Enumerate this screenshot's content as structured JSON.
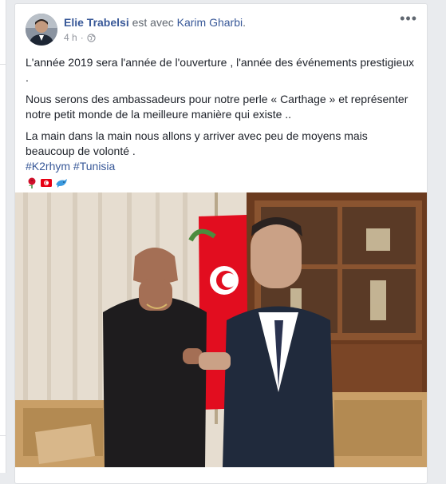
{
  "post": {
    "author": "Elie Trabelsi",
    "with_text": "est avec",
    "tagged": "Karim Gharbi",
    "tagged_suffix": ".",
    "time": "4 h",
    "more": "•••",
    "paragraphs": [
      "L'année 2019 sera l'année de l'ouverture , l'année des événements prestigieux .",
      "Nous serons des ambassadeurs pour notre perle « Carthage » et représenter notre petit monde de la meilleure manière qui existe ..",
      "La main dans la main nous allons y arriver avec peu de moyens mais beaucoup de volonté ."
    ],
    "hashtags": [
      "#K2rhym",
      "#Tunisia"
    ],
    "emojis": [
      "rose-emoji",
      "tunisia-flag-emoji",
      "dolphin-emoji"
    ],
    "icons": {
      "privacy": "globe-icon",
      "more": "more-options-icon"
    }
  },
  "colors": {
    "link": "#385898",
    "text": "#1d2129",
    "meta": "#90949c",
    "background": "#e9ebee"
  }
}
